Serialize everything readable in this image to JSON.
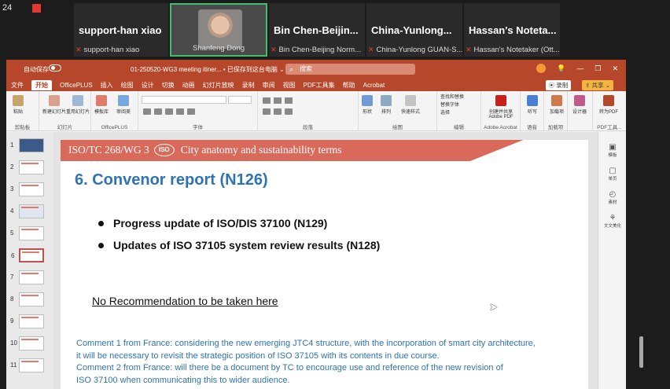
{
  "meeting": {
    "counter": "24",
    "participants": [
      {
        "name": "support-han xiao",
        "label": "support-han xiao"
      },
      {
        "name": "",
        "label": "Shanfeng Dong",
        "video": true
      },
      {
        "name": "Bin  Chen-Beijin...",
        "label": "Bin Chen-Beijing Norm..."
      },
      {
        "name": "China-Yunlong...",
        "label": "China-Yunlong GUAN-S..."
      },
      {
        "name": "Hassan's  Noteta...",
        "label": "Hassan's Notetaker (Ott..."
      }
    ]
  },
  "ppt": {
    "autosave": "自动保存",
    "doc_title": "01-250520-WG3 meeting itiner... • 已保存到这台电脑 ⌄",
    "search_placeholder": "搜索",
    "tabs": [
      "文件",
      "开始",
      "OfficePLUS",
      "插入",
      "绘图",
      "设计",
      "切换",
      "动画",
      "幻灯片放映",
      "录制",
      "审阅",
      "视图",
      "PDF工具集",
      "帮助",
      "Acrobat"
    ],
    "active_tab": "开始",
    "record_label": "⦿ 录制",
    "share_label": "⇪ 共享 ⌄",
    "ribbon_groups": [
      {
        "label": "剪贴板",
        "buttons": [
          "粘贴"
        ]
      },
      {
        "label": "幻灯片",
        "buttons": [
          "新建幻灯片",
          "重用幻灯片"
        ]
      },
      {
        "label": "OfficePLUS",
        "buttons": [
          "模板库",
          "审阅美"
        ]
      },
      {
        "label": "字体",
        "buttons": []
      },
      {
        "label": "段落",
        "buttons": []
      },
      {
        "label": "绘图",
        "buttons": [
          "形状",
          "排列",
          "快速样式"
        ]
      },
      {
        "label": "编辑",
        "buttons": [
          "查找和替换",
          "替换字体",
          "选择"
        ]
      },
      {
        "label": "Adobe Acrobat",
        "buttons": [
          "创建并共享Adobe PDF"
        ]
      },
      {
        "label": "语音",
        "buttons": [
          "听写"
        ]
      },
      {
        "label": "加载项",
        "buttons": [
          "加载项"
        ]
      },
      {
        "label": "",
        "buttons": [
          "设计器"
        ]
      },
      {
        "label": "PDF工具...",
        "buttons": [
          "转为PDF"
        ]
      }
    ],
    "right_pane": [
      "模板",
      "单页",
      "素材",
      "文文美化"
    ],
    "thumb_numbers": [
      "1",
      "2",
      "3",
      "4",
      "5",
      "6",
      "7",
      "8",
      "9",
      "10",
      "11"
    ],
    "selected_thumb": "6"
  },
  "slide": {
    "banner_left": "ISO/TC 268/WG 3",
    "banner_logo": "ISO",
    "banner_right": "City anatomy and sustainability terms",
    "title": "6. Convenor report (N126)",
    "bullets": [
      "Progress update of ISO/DIS 37100 (N129)",
      "Updates of ISO 37105 system review results (N128)"
    ],
    "no_recommendation": "No Recommendation to be taken here",
    "comments": [
      "Comment 1 from France: considering the new emerging JTC4 structure, with the incorporation of smart city architecture,",
      " it will be necessary to revisit the strategic position of ISO 37105 with its contents in due course.",
      "Comment 2 from France: will there be a document by TC to encourage use and reference of the new revision of",
      "ISO 37100 when communicating this to wider audience."
    ]
  },
  "colors": {
    "ppt_accent": "#b7472a",
    "banner": "#d96a5b",
    "title_blue": "#2e74b5",
    "active_tile": "#3fbf6a"
  }
}
